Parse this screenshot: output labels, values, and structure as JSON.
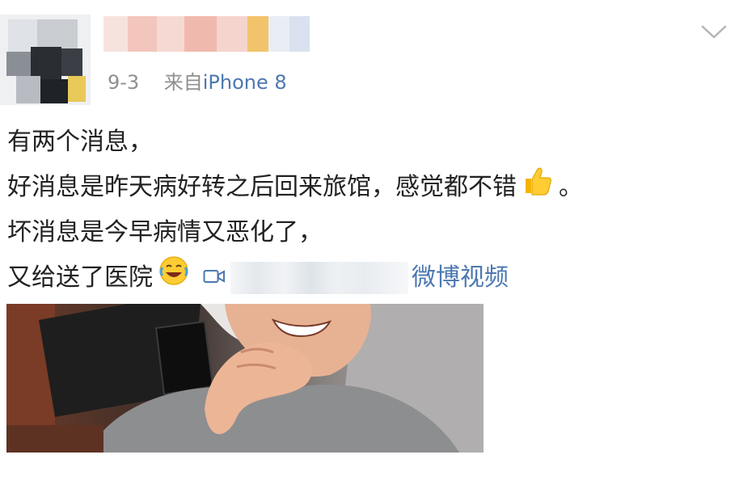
{
  "post": {
    "time": "9-3",
    "source_prefix": "来自",
    "source_device": "iPhone 8",
    "lines": [
      "有两个消息，",
      "好消息是昨天病好转之后回来旅馆，感觉都不错",
      "坏消息是今早病情又恶化了，",
      "又给送了医院"
    ],
    "line2_end": "。",
    "video_link_suffix": "微博视频"
  },
  "icons": {
    "more": "chevron-down-icon",
    "thumbs_up": "thumbs-up-emoji",
    "laugh_cry": "laugh-cry-emoji",
    "video": "video-camera-icon"
  },
  "colors": {
    "link": "#4c78b0",
    "meta": "#8f8f8f",
    "text": "#222222"
  }
}
